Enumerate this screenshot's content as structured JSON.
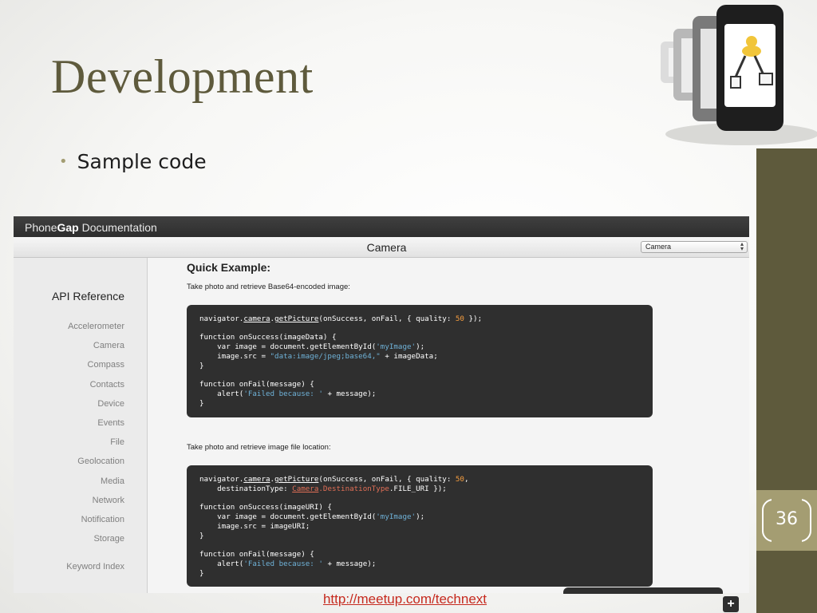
{
  "slide": {
    "title": "Development",
    "bullet": "Sample code",
    "page_number": "36",
    "link": "http://meetup.com/technext",
    "colors": {
      "title": "#5e5a3c",
      "band": "#5e5a3c",
      "page_box": "#a49d72",
      "link": "#c62a1f"
    }
  },
  "doc": {
    "brand_light": "Phone",
    "brand_bold": "Gap",
    "brand_rest": " Documentation",
    "page_title": "Camera",
    "select_value": "Camera",
    "api_heading": "API Reference",
    "api_items": [
      "Accelerometer",
      "Camera",
      "Compass",
      "Contacts",
      "Device",
      "Events",
      "File",
      "Geolocation",
      "Media",
      "Network",
      "Notification",
      "Storage"
    ],
    "keyword_index": "Keyword Index",
    "quick_title": "Quick Example:",
    "desc1": "Take photo and retrieve Base64-encoded image:",
    "desc2": "Take photo and retrieve image file location:",
    "code1": {
      "l1a": "navigator.",
      "l1b": "camera",
      "l1c": ".",
      "l1d": "getPicture",
      "l1e": "(onSuccess, onFail, { quality: ",
      "l1f": "50",
      "l1g": " });",
      "l2": "function onSuccess(imageData) {",
      "l3a": "    var image = document.getElementById(",
      "l3b": "'myImage'",
      "l3c": ");",
      "l4a": "    image.src = ",
      "l4b": "\"data:image/jpeg;base64,\"",
      "l4c": " + imageData;",
      "l5": "}",
      "l6": "function onFail(message) {",
      "l7a": "    alert(",
      "l7b": "'Failed because: '",
      "l7c": " + message);",
      "l8": "}"
    },
    "code2": {
      "l1a": "navigator.",
      "l1b": "camera",
      "l1c": ".",
      "l1d": "getPicture",
      "l1e": "(onSuccess, onFail, { quality: ",
      "l1f": "50",
      "l1g": ",",
      "l2a": "    destinationType: ",
      "l2b": "Camera",
      "l2c": ".DestinationType",
      "l2d": ".FILE_URI });",
      "l3": "function onSuccess(imageURI) {",
      "l4a": "    var image = document.getElementById(",
      "l4b": "'myImage'",
      "l4c": ");",
      "l5": "    image.src = imageURI;",
      "l6": "}",
      "l7": "function onFail(message) {",
      "l8a": "    alert(",
      "l8b": "'Failed because: '",
      "l8c": " + message);",
      "l9": "}"
    },
    "plus_label": "+"
  }
}
